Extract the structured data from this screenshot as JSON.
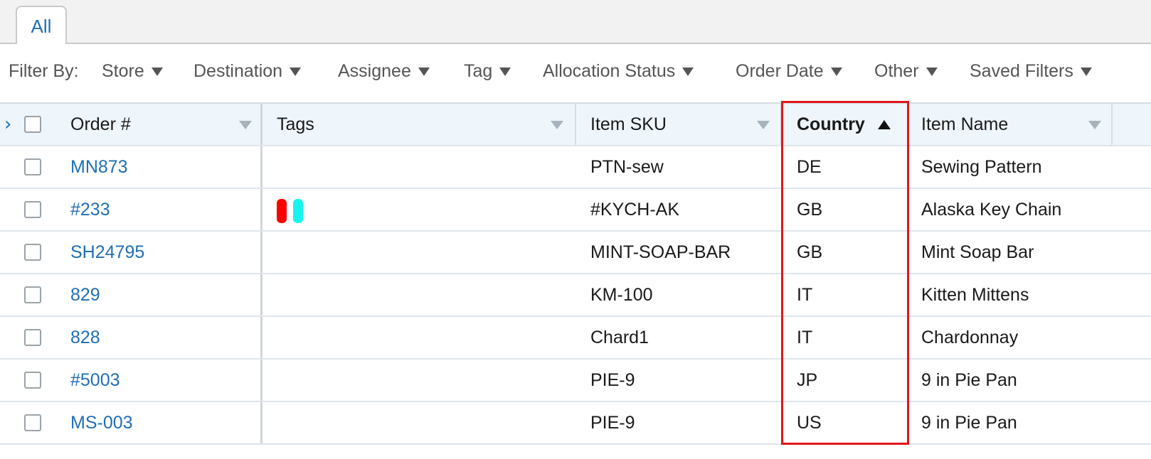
{
  "tabs": [
    {
      "label": "All",
      "active": true
    }
  ],
  "filters": {
    "label": "Filter By:",
    "items": [
      "Store",
      "Destination",
      "Assignee",
      "Tag",
      "Allocation Status",
      "Order Date",
      "Other",
      "Saved Filters"
    ]
  },
  "table": {
    "columns": [
      "Order #",
      "Tags",
      "Item SKU",
      "Country",
      "Item Name"
    ],
    "sorted_column": "Country",
    "sort_direction": "ascending",
    "rows": [
      {
        "order": "MN873",
        "tags": [],
        "sku": "PTN-sew",
        "country": "DE",
        "item_name": "Sewing Pattern"
      },
      {
        "order": "#233",
        "tags": [
          "#ff0000",
          "#19f3f0"
        ],
        "sku": "#KYCH-AK",
        "country": "GB",
        "item_name": "Alaska Key Chain"
      },
      {
        "order": "SH24795",
        "tags": [],
        "sku": "MINT-SOAP-BAR",
        "country": "GB",
        "item_name": "Mint Soap Bar"
      },
      {
        "order": "829",
        "tags": [],
        "sku": "KM-100",
        "country": "IT",
        "item_name": "Kitten Mittens"
      },
      {
        "order": "828",
        "tags": [],
        "sku": "Chard1",
        "country": "IT",
        "item_name": "Chardonnay"
      },
      {
        "order": "#5003",
        "tags": [],
        "sku": "PIE-9",
        "country": "JP",
        "item_name": "9 in Pie Pan"
      },
      {
        "order": "MS-003",
        "tags": [],
        "sku": "PIE-9",
        "country": "US",
        "item_name": "9 in Pie Pan"
      }
    ]
  },
  "colors": {
    "link": "#1f6fb5",
    "highlight": "#e0161b",
    "header_bg": "#eef5fb"
  }
}
